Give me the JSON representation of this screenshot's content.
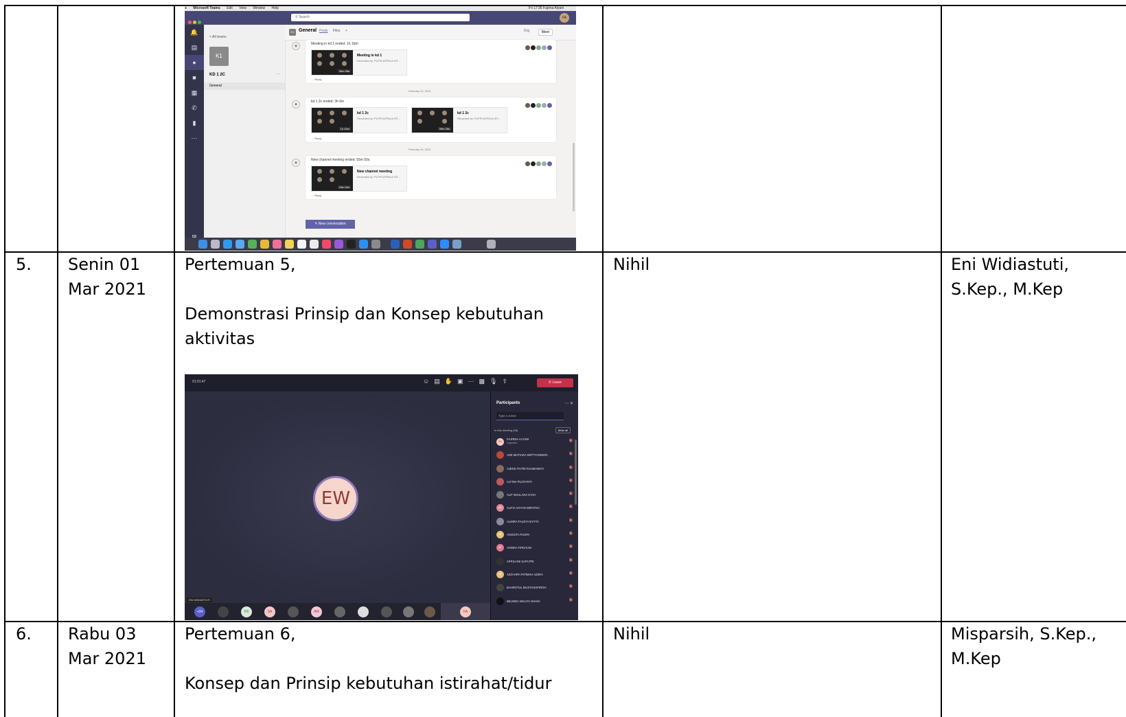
{
  "table": {
    "rows": [
      {
        "number": "5.",
        "date": "Senin 01\nMar 2021",
        "activity_line1": "Pertemuan 5,",
        "activity_line2": "Demonstrasi Prinsip dan Konsep kebutuhan\naktivitas",
        "obstacle": "Nihil",
        "lecturer": "Eni Widiastuti,\nS.Kep., M.Kep"
      },
      {
        "number": "6.",
        "date": "Rabu 03\nMar 2021",
        "activity_line1": "Pertemuan 6,",
        "activity_line2": "Konsep dan Prinsip kebutuhan istirahat/tidur",
        "obstacle": "Nihil",
        "lecturer": "Misparsih, S.Kep.,\nM.Kep"
      }
    ]
  },
  "teams_channel_screenshot": {
    "menubar": [
      "Microsoft Teams",
      "Edit",
      "View",
      "Window",
      "Help"
    ],
    "menubar_right": "Fri 17:36  Fajrina Alyani",
    "search_placeholder": "Search",
    "user_initials": "FA",
    "rail_items": [
      "activity-icon",
      "chat-icon",
      "teams-icon",
      "assignments-icon",
      "calendar-icon",
      "calls-icon",
      "files-icon",
      "more-icon",
      "apps-icon",
      "help-icon"
    ],
    "all_teams": "< All teams",
    "team_tile": "K1",
    "team_name": "KD 1 2C",
    "team_more": "···",
    "channel_general": "General",
    "channel_badge": "K1",
    "channel_title": "General",
    "tabs": [
      "Posts",
      "Files",
      "+"
    ],
    "org": "Org",
    "meet": "Meet",
    "posts": [
      {
        "title": "Meeting in kd 1 ended: 1h 1bm",
        "recordings": [
          {
            "title": "Meeting in kd 1",
            "by": "Recorded by: PUTRI AFRILIA IST...",
            "duration": "30m 46s"
          }
        ],
        "reply": "← Reply"
      },
      {
        "title": "kd 1 2c ended: 3h 6m",
        "recordings": [
          {
            "title": "kd 1 2c",
            "by": "Recorded by: PUTRI AFRILIA IST...",
            "duration": "1h 43m"
          },
          {
            "title": "kd 1 2c",
            "by": "Recorded by: PUTRI AFRILIA IST...",
            "duration": "39m 39s"
          }
        ],
        "reply": "← Reply"
      },
      {
        "title": "New channel meeting ended: 55m 50s",
        "recordings": [
          {
            "title": "New channel meeting",
            "by": "Recorded by: PUTRI AFRILIA IST...",
            "duration": "24m 54s"
          }
        ],
        "reply": "← Reply"
      }
    ],
    "dates": [
      "February 22, 2021",
      "February 24, 2021"
    ],
    "new_conversation": "New conversation"
  },
  "teams_meeting_screenshot": {
    "elapsed_time": "01:01:47",
    "leave_label": "Leave",
    "stage_initials": "EW",
    "stage_name": "ENI WIDIASTUTI",
    "strip_avatars": [
      "+34",
      "",
      "FS",
      "SA",
      "",
      "AW",
      "",
      "",
      "",
      "",
      ""
    ],
    "self_initials": "FA",
    "panel_title": "Participants",
    "search_placeholder": "Type a name",
    "in_meeting": "In this meeting (46)",
    "mute_all": "Mute all",
    "participants": [
      {
        "name": "FAJRINA ALYANI",
        "role": "Organizer",
        "initials": "FA"
      },
      {
        "name": "ADE MUTIARA SEPTYANINGR...",
        "initials": ""
      },
      {
        "name": "AJENG PUTRI RAHMAWATI",
        "initials": ""
      },
      {
        "name": "ALFINA PUJIYANTI",
        "initials": ""
      },
      {
        "name": "ALIF MAULANA SYAH",
        "initials": ""
      },
      {
        "name": "ALIFIA AGYAN WIRATNA",
        "initials": "AA"
      },
      {
        "name": "ALMIRA FAUZYA EVYTA",
        "initials": ""
      },
      {
        "name": "ANGGITA PUSPA",
        "initials": "AP"
      },
      {
        "name": "ANNISA FIRDAUSI",
        "initials": "AF"
      },
      {
        "name": "APRILIANI SAPUTRI",
        "initials": ""
      },
      {
        "name": "AZZAHRA FATIMAH AZZRA",
        "initials": "AA"
      },
      {
        "name": "BAHROTUL MUSTAGHFIROH",
        "initials": ""
      },
      {
        "name": "BELINDA WALIYA SHAVA",
        "initials": ""
      }
    ]
  }
}
